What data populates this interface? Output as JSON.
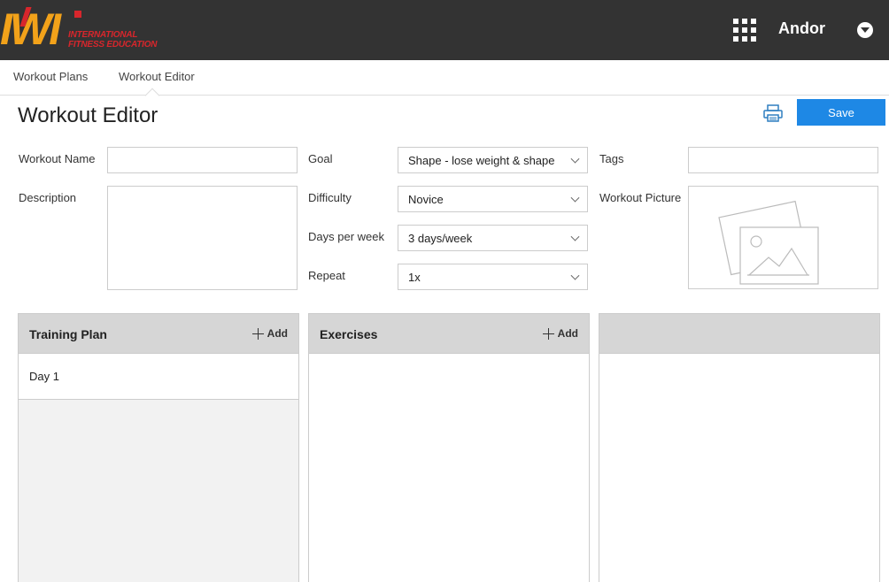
{
  "header": {
    "logo_text": "IWI",
    "logo_subtext_line1": "INTERNATIONAL",
    "logo_subtext_line2": "FITNESS EDUCATION",
    "username": "Andor",
    "colors": {
      "topbar": "#333333",
      "logo_orange": "#f2a21a",
      "logo_red": "#d8262c"
    }
  },
  "nav": {
    "tabs": [
      {
        "label": "Workout Plans"
      },
      {
        "label": "Workout Editor",
        "active": true
      }
    ]
  },
  "page": {
    "title": "Workout Editor",
    "save_label": "Save",
    "accent": "#1e88e5"
  },
  "form": {
    "workout_name_label": "Workout Name",
    "workout_name_value": "",
    "description_label": "Description",
    "description_value": "",
    "goal_label": "Goal",
    "goal_value": "Shape - lose weight & shape",
    "difficulty_label": "Difficulty",
    "difficulty_value": "Novice",
    "days_label": "Days per week",
    "days_value": "3 days/week",
    "repeat_label": "Repeat",
    "repeat_value": "1x",
    "tags_label": "Tags",
    "tags_value": "",
    "picture_label": "Workout Picture"
  },
  "panels": {
    "training_plan": {
      "title": "Training Plan",
      "add_label": "Add",
      "days": [
        "Day 1"
      ]
    },
    "exercises": {
      "title": "Exercises",
      "add_label": "Add"
    },
    "details": {
      "title": ""
    }
  },
  "icons": [
    "apps-grid-icon",
    "chevron-down-icon",
    "print-icon",
    "image-placeholder-icon",
    "plus-icon"
  ]
}
